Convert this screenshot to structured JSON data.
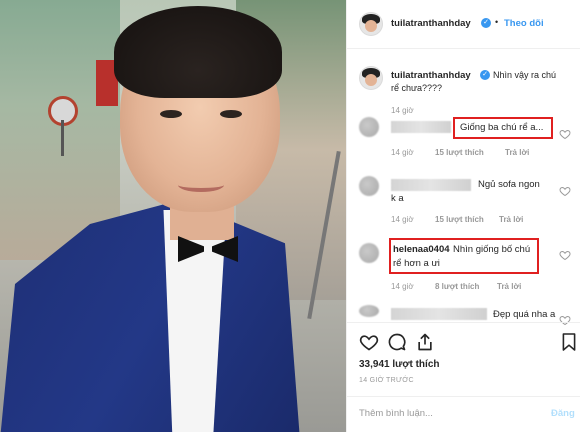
{
  "post": {
    "username": "tuilatranthanhday",
    "follow_label": "Theo dõi",
    "caption": {
      "username": "tuilatranthanhday",
      "text_line1": "Nhìn vậy ra chú",
      "text_line2": "rể chưa????",
      "time": "14 giờ"
    },
    "comments": [
      {
        "text": "Giống ba chú rể a...",
        "time": "14 giờ",
        "likes": "15 lượt thích",
        "reply": "Trả lời"
      },
      {
        "text_line1": "Ngủ sofa ngon",
        "text_line2": "k a",
        "time": "14 giờ",
        "likes": "15 lượt thích",
        "reply": "Trả lời"
      },
      {
        "username": "helenaa0404",
        "text_line1": "Nhìn giống bố chú",
        "text_line2": "rể hơn a ưi",
        "time": "14 giờ",
        "likes": "8 lượt thích",
        "reply": "Trả lời"
      },
      {
        "text": "Đẹp quá nha a"
      }
    ],
    "likes_count": "33,941 lượt thích",
    "timestamp": "14 GIỜ TRƯỚC",
    "comment_placeholder": "Thêm bình luận...",
    "post_label": "Đăng",
    "colors": {
      "link": "#3897f0",
      "highlight": "#e02020",
      "muted": "#999999"
    },
    "icons": [
      "more-options-icon",
      "heart-icon",
      "comment-icon",
      "share-icon",
      "bookmark-icon",
      "verified-icon"
    ]
  }
}
